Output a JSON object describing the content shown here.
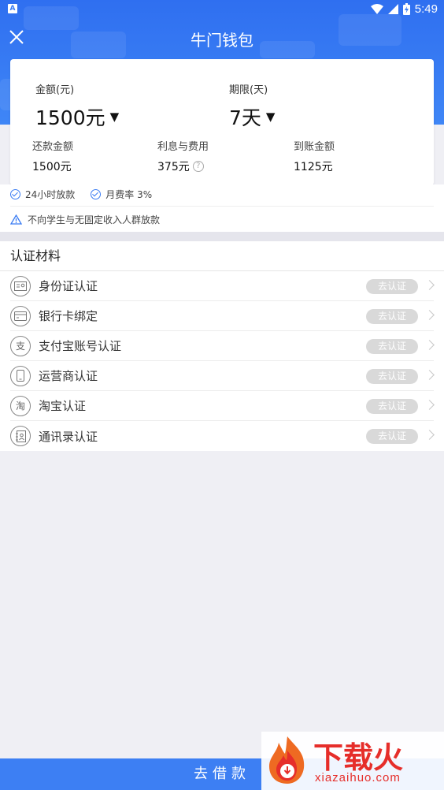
{
  "status_bar": {
    "app_badge": "A",
    "time": "5:49"
  },
  "nav": {
    "title": "牛门钱包"
  },
  "loan": {
    "amount_label": "金额(元)",
    "amount_value": "1500元",
    "term_label": "期限(天)",
    "term_value": "7天",
    "stats": [
      {
        "label": "还款金额",
        "value": "1500元"
      },
      {
        "label": "利息与费用",
        "value": "375元"
      },
      {
        "label": "到账金额",
        "value": "1125元"
      }
    ]
  },
  "features": {
    "tag1": "24小时放款",
    "tag2": "月费率 3%",
    "notice": "不向学生与无固定收入人群放款"
  },
  "verification": {
    "heading": "认证材料",
    "button_label": "去认证",
    "items": [
      {
        "name": "身份证认证",
        "icon": "id-card-icon"
      },
      {
        "name": "银行卡绑定",
        "icon": "bank-card-icon"
      },
      {
        "name": "支付宝账号认证",
        "icon": "alipay-icon"
      },
      {
        "name": "运营商认证",
        "icon": "phone-icon"
      },
      {
        "name": "淘宝认证",
        "icon": "taobao-icon"
      },
      {
        "name": "通讯录认证",
        "icon": "contacts-icon"
      }
    ]
  },
  "footer": {
    "borrow_button": "去借款"
  },
  "watermark": {
    "brand": "下载火",
    "url": "xiazaihuo.com"
  },
  "colors": {
    "primary": "#3d7ff3",
    "header_top": "#2f6ff0",
    "watermark_red": "#e62e2a"
  }
}
